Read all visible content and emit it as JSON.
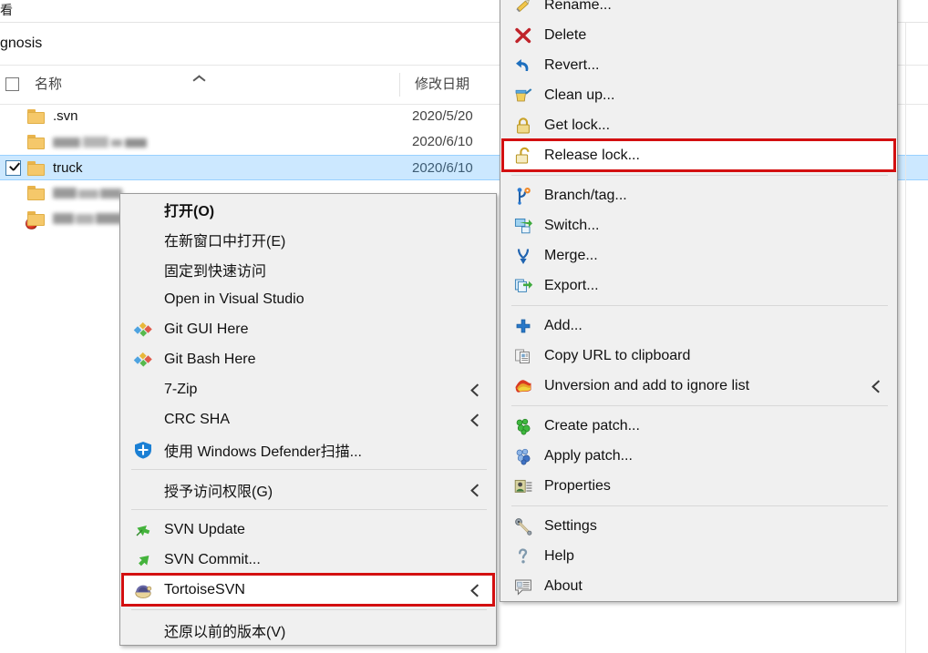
{
  "window": {
    "ribbon_tab_partial": "看",
    "breadcrumb_partial": "gnosis"
  },
  "columns": {
    "name": "名称",
    "date_modified": "修改日期"
  },
  "files": [
    {
      "name": ".svn",
      "date": "2020/5/20",
      "overlay": "none",
      "checked": false,
      "selected": false,
      "redacted": false
    },
    {
      "name": "",
      "date": "2020/6/10",
      "overlay": "green",
      "checked": false,
      "selected": false,
      "redacted": true
    },
    {
      "name": "truck",
      "date": "2020/6/10",
      "overlay": "red",
      "checked": true,
      "selected": true,
      "redacted": false
    },
    {
      "name": "",
      "date": "",
      "overlay": "green",
      "checked": false,
      "selected": false,
      "redacted": true
    },
    {
      "name": "",
      "date": "",
      "overlay": "green",
      "checked": false,
      "selected": false,
      "redacted": true
    }
  ],
  "context_menu": {
    "items": [
      {
        "label": "打开(O)",
        "icon": "none",
        "bold": true,
        "submenu": false,
        "separator_after": false
      },
      {
        "label": "在新窗口中打开(E)",
        "icon": "none",
        "bold": false,
        "submenu": false,
        "separator_after": false
      },
      {
        "label": "固定到快速访问",
        "icon": "none",
        "bold": false,
        "submenu": false,
        "separator_after": false
      },
      {
        "label": "Open in Visual Studio",
        "icon": "none",
        "bold": false,
        "submenu": false,
        "separator_after": false
      },
      {
        "label": "Git GUI Here",
        "icon": "git-icon",
        "bold": false,
        "submenu": false,
        "separator_after": false
      },
      {
        "label": "Git Bash Here",
        "icon": "git-icon",
        "bold": false,
        "submenu": false,
        "separator_after": false
      },
      {
        "label": "7-Zip",
        "icon": "none",
        "bold": false,
        "submenu": true,
        "separator_after": false
      },
      {
        "label": "CRC SHA",
        "icon": "none",
        "bold": false,
        "submenu": true,
        "separator_after": false
      },
      {
        "label": "使用 Windows Defender扫描...",
        "icon": "defender-shield-icon",
        "bold": false,
        "submenu": false,
        "separator_after": true
      },
      {
        "label": "授予访问权限(G)",
        "icon": "none",
        "bold": false,
        "submenu": true,
        "separator_after": true
      },
      {
        "label": "SVN Update",
        "icon": "svn-update-icon",
        "bold": false,
        "submenu": false,
        "separator_after": false
      },
      {
        "label": "SVN Commit...",
        "icon": "svn-commit-icon",
        "bold": false,
        "submenu": false,
        "separator_after": false
      },
      {
        "label": "TortoiseSVN",
        "icon": "tortoise-icon",
        "bold": false,
        "submenu": true,
        "separator_after": true,
        "highlighted": true
      },
      {
        "label": "还原以前的版本(V)",
        "icon": "none",
        "bold": false,
        "submenu": false,
        "separator_after": false
      }
    ]
  },
  "tortoise_submenu": {
    "items": [
      {
        "label": "Rename...",
        "icon": "pencil-icon",
        "submenu": false,
        "separator_after": false
      },
      {
        "label": "Delete",
        "icon": "red-x-icon",
        "submenu": false,
        "separator_after": false
      },
      {
        "label": "Revert...",
        "icon": "undo-arrow-icon",
        "submenu": false,
        "separator_after": false
      },
      {
        "label": "Clean up...",
        "icon": "broom-icon",
        "submenu": false,
        "separator_after": false
      },
      {
        "label": "Get lock...",
        "icon": "lock-closed-icon",
        "submenu": false,
        "separator_after": false
      },
      {
        "label": "Release lock...",
        "icon": "lock-open-icon",
        "submenu": false,
        "separator_after": true,
        "highlighted": true
      },
      {
        "label": "Branch/tag...",
        "icon": "branch-icon",
        "submenu": false,
        "separator_after": false
      },
      {
        "label": "Switch...",
        "icon": "switch-icon",
        "submenu": false,
        "separator_after": false
      },
      {
        "label": "Merge...",
        "icon": "merge-icon",
        "submenu": false,
        "separator_after": false
      },
      {
        "label": "Export...",
        "icon": "export-icon",
        "submenu": false,
        "separator_after": true
      },
      {
        "label": "Add...",
        "icon": "add-plus-icon",
        "submenu": false,
        "separator_after": false
      },
      {
        "label": "Copy URL to clipboard",
        "icon": "clipboard-icon",
        "submenu": false,
        "separator_after": false
      },
      {
        "label": "Unversion and add to ignore list",
        "icon": "ignore-icon",
        "submenu": true,
        "separator_after": true
      },
      {
        "label": "Create patch...",
        "icon": "patch-green-icon",
        "submenu": false,
        "separator_after": false
      },
      {
        "label": "Apply patch...",
        "icon": "patch-blue-icon",
        "submenu": false,
        "separator_after": false
      },
      {
        "label": "Properties",
        "icon": "properties-icon",
        "submenu": false,
        "separator_after": true
      },
      {
        "label": "Settings",
        "icon": "settings-icon",
        "submenu": false,
        "separator_after": false
      },
      {
        "label": "Help",
        "icon": "help-icon",
        "submenu": false,
        "separator_after": false
      },
      {
        "label": "About",
        "icon": "about-icon",
        "submenu": false,
        "separator_after": false
      }
    ]
  },
  "annotations": {
    "highlight_color": "#d30f10",
    "boxes": [
      {
        "target": "TortoiseSVN"
      },
      {
        "target": "Release lock..."
      }
    ]
  }
}
